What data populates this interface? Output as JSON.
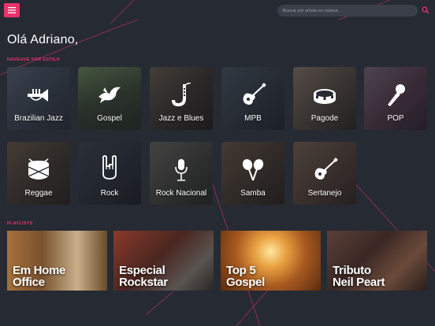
{
  "header": {
    "menu_icon": "hamburger-icon",
    "search_placeholder": "Buscar por artista ou música",
    "search_icon": "search-icon"
  },
  "greeting": "Olá Adriano,",
  "styles_section": {
    "label": "NAVEGUE POR ESTILO",
    "items": [
      {
        "label": "Brazilian Jazz",
        "icon": "trumpet-icon"
      },
      {
        "label": "Gospel",
        "icon": "dove-icon"
      },
      {
        "label": "Jazz e Blues",
        "icon": "saxophone-icon"
      },
      {
        "label": "MPB",
        "icon": "guitar-icon"
      },
      {
        "label": "Pagode",
        "icon": "tambourine-icon"
      },
      {
        "label": "POP",
        "icon": "microphone-icon"
      },
      {
        "label": "Reggae",
        "icon": "drum-icon"
      },
      {
        "label": "Rock",
        "icon": "rock-hand-icon"
      },
      {
        "label": "Rock Nacional",
        "icon": "microphone-icon"
      },
      {
        "label": "Samba",
        "icon": "maracas-icon"
      },
      {
        "label": "Sertanejo",
        "icon": "guitar-icon"
      }
    ]
  },
  "playlists_section": {
    "label": "PLAYLISTS",
    "items": [
      {
        "title": "Em Home\nOffice"
      },
      {
        "title": "Especial\nRockstar"
      },
      {
        "title": "Top 5\nGospel"
      },
      {
        "title": "Tributo\nNeil Peart"
      }
    ]
  },
  "colors": {
    "accent": "#e8336b",
    "background": "#262a33"
  }
}
